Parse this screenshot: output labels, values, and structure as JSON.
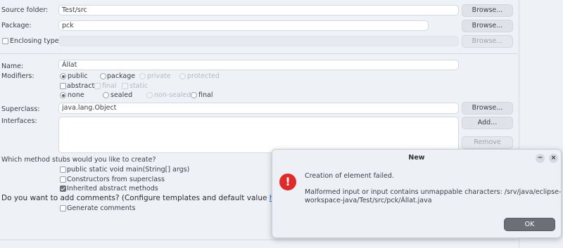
{
  "form": {
    "source_folder": {
      "label": "Source folder:",
      "value": "Test/src",
      "browse": "Browse..."
    },
    "package": {
      "label": "Package:",
      "value": "pck",
      "browse": "Browse..."
    },
    "enclosing_type": {
      "label": "Enclosing type:",
      "value": "",
      "browse": "Browse..."
    },
    "name": {
      "label": "Name:",
      "value": "Állat"
    },
    "modifiers": {
      "label": "Modifiers:",
      "row1": [
        "public",
        "package",
        "private",
        "protected"
      ],
      "row2": [
        "abstract",
        "final",
        "static"
      ],
      "row3": [
        "none",
        "sealed",
        "non-sealed",
        "final"
      ]
    },
    "superclass": {
      "label": "Superclass:",
      "value": "java.lang.Object",
      "browse": "Browse..."
    },
    "interfaces": {
      "label": "Interfaces:",
      "add": "Add...",
      "remove": "Remove"
    },
    "stubs": {
      "question": "Which method stubs would you like to create?",
      "options": [
        "public static void main(String[] args)",
        "Constructors from superclass",
        "Inherited abstract methods"
      ]
    },
    "comments": {
      "question_prefix": "Do you want to add comments? (Configure templates and default value ",
      "link": "here",
      "question_suffix": ")",
      "generate": "Generate comments"
    }
  },
  "dialog": {
    "title": "New",
    "minimize": "−",
    "close": "×",
    "icon": "error-icon",
    "icon_glyph": "!",
    "heading": "Creation of element failed.",
    "message_line1": "Malformed input or input contains unmappable characters: /srv/java/eclipse-",
    "message_line2": "workspace-java/Test/src/pck/Állat.java",
    "ok": "OK"
  },
  "colors": {
    "error": "#e02b2b",
    "link": "#1f63c9",
    "ok_button": "#6c7076"
  }
}
